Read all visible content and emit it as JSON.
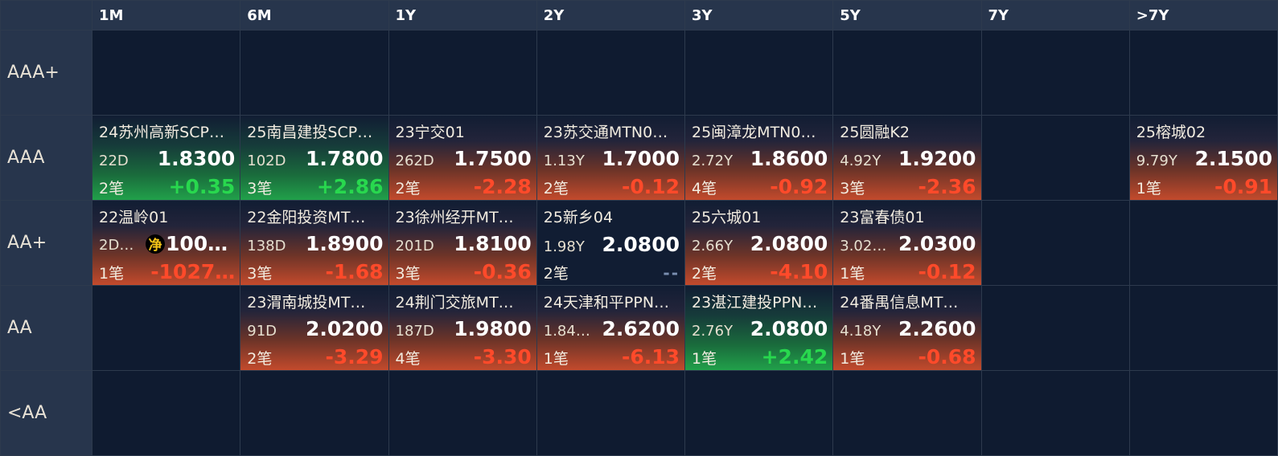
{
  "columns": [
    "1M",
    "6M",
    "1Y",
    "2Y",
    "3Y",
    "5Y",
    "7Y",
    ">7Y"
  ],
  "rows": [
    "AAA+",
    "AAA",
    "AA+",
    "AA",
    "<AA"
  ],
  "colors": {
    "down": "#ff4a2a",
    "up": "#28d84e",
    "header_bg": "#27354c",
    "cell_bg": "#0f1b30"
  },
  "cells": {
    "r1c0": {
      "name": "24苏州高新SCP…",
      "term": "22D",
      "price": "1.8300",
      "count": "2笔",
      "change": "+0.35",
      "dir": "up"
    },
    "r1c1": {
      "name": "25南昌建投SCP…",
      "term": "102D",
      "price": "1.7800",
      "count": "3笔",
      "change": "+2.86",
      "dir": "up"
    },
    "r1c2": {
      "name": "23宁交01",
      "term": "262D",
      "price": "1.7500",
      "count": "2笔",
      "change": "-2.28",
      "dir": "down"
    },
    "r1c3": {
      "name": "23苏交通MTN0…",
      "term": "1.13Y",
      "price": "1.7000",
      "count": "2笔",
      "change": "-0.12",
      "dir": "down"
    },
    "r1c4": {
      "name": "25闽漳龙MTN0…",
      "term": "2.72Y",
      "price": "1.8600",
      "count": "4笔",
      "change": "-0.92",
      "dir": "down"
    },
    "r1c5": {
      "name": "25圆融K2",
      "term": "4.92Y",
      "price": "1.9200",
      "count": "3笔",
      "change": "-2.36",
      "dir": "down"
    },
    "r1c7": {
      "name": "25榕城02",
      "term": "9.79Y",
      "price": "2.1500",
      "count": "1笔",
      "change": "-0.91",
      "dir": "down"
    },
    "r2c0": {
      "name": "22温岭01",
      "term": "2D+…",
      "badge": "净",
      "price": "100.…",
      "count": "1笔",
      "change": "-1027…",
      "dir": "down"
    },
    "r2c1": {
      "name": "22金阳投资MT…",
      "term": "138D",
      "price": "1.8900",
      "count": "3笔",
      "change": "-1.68",
      "dir": "down"
    },
    "r2c2": {
      "name": "23徐州经开MT…",
      "term": "201D",
      "price": "1.8100",
      "count": "3笔",
      "change": "-0.36",
      "dir": "down"
    },
    "r2c3": {
      "name": "25新乡04",
      "term": "1.98Y",
      "price": "2.0800",
      "count": "2笔",
      "change": "--",
      "dir": "none"
    },
    "r2c4": {
      "name": "25六城01",
      "term": "2.66Y",
      "price": "2.0800",
      "count": "2笔",
      "change": "-4.10",
      "dir": "down"
    },
    "r2c5": {
      "name": "23富春债01",
      "term": "3.02…",
      "price": "2.0300",
      "count": "1笔",
      "change": "-0.12",
      "dir": "down"
    },
    "r3c1": {
      "name": "23渭南城投MT…",
      "term": "91D",
      "price": "2.0200",
      "count": "2笔",
      "change": "-3.29",
      "dir": "down"
    },
    "r3c2": {
      "name": "24荆门交旅MT…",
      "term": "187D",
      "price": "1.9800",
      "count": "4笔",
      "change": "-3.30",
      "dir": "down"
    },
    "r3c3": {
      "name": "24天津和平PPN…",
      "term": "1.84…",
      "price": "2.6200",
      "count": "1笔",
      "change": "-6.13",
      "dir": "down"
    },
    "r3c4": {
      "name": "23湛江建投PPN…",
      "term": "2.76Y",
      "price": "2.0800",
      "count": "1笔",
      "change": "+2.42",
      "dir": "up"
    },
    "r3c5": {
      "name": "24番禺信息MT…",
      "term": "4.18Y",
      "price": "2.2600",
      "count": "1笔",
      "change": "-0.68",
      "dir": "down"
    }
  }
}
